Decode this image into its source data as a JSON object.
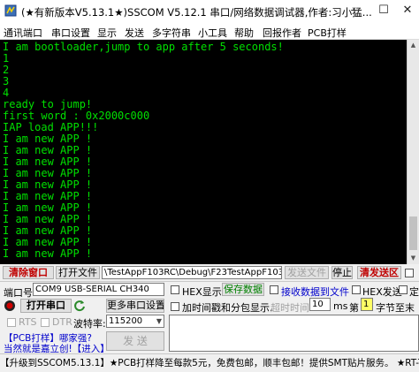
{
  "window": {
    "title": "(★有新版本V5.13.1★)SSCOM V5.12.1 串口/网络数据调试器,作者:习小猛...",
    "min": "—",
    "max": "☐",
    "close": "✕"
  },
  "menu": [
    "通讯端口",
    "串口设置",
    "显示",
    "发送",
    "多字符串",
    "小工具",
    "帮助",
    "回报作者",
    "PCB打样"
  ],
  "terminal": {
    "lines": [
      "I am bootloader,jump to app after 5 seconds!",
      "1",
      "2",
      "3",
      "4",
      "ready to jump!",
      "first word : 0x2000c000",
      "IAP load APP!!!",
      "I am new APP !",
      "I am new APP !",
      "I am new APP !",
      "I am new APP !",
      "I am new APP !",
      "I am new APP !",
      "I am new APP !",
      "I am new APP !",
      "I am new APP !",
      "I am new APP !",
      "I am new APP !"
    ],
    "scroll_up": "▲",
    "scroll_down": "▼"
  },
  "row1": {
    "clear": "清除窗口",
    "open_file": "打开文件",
    "file_path": "\\TestAppF103RC\\Debug\\F23TestAppF103RC.bin",
    "send_file": "发送文件",
    "stop": "停止",
    "clear_send": "清发送区",
    "extra_check": ""
  },
  "row2": {
    "port_label": "端口号",
    "port_value": "COM9 USB-SERIAL CH340",
    "hex_display": "HEX显示",
    "save_data": "保存数据",
    "recv_to_file": "接收数据到文件",
    "hex_send": "HEX发送",
    "timed": "定"
  },
  "row3": {
    "open_port": "打开串口",
    "more_settings": "更多串口设置",
    "timestamp": "加时间戳和分包显示.",
    "timeout": "超时时间",
    "timeout_value": "10",
    "ms": "ms",
    "page_label": "第",
    "page_value": "1",
    "byte_label": "字节至末"
  },
  "row4": {
    "rts": "RTS",
    "dtr": "DTR",
    "baud_label": "波特率:",
    "baud_value": "115200"
  },
  "promo": {
    "line1": "【PCB打样】哪家强?",
    "line2": "当然就是嘉立创!【进入】",
    "send": "发 送"
  },
  "status": "【升级到SSCOM5.13.1】★PCB打样降至每款5元，免费包邮，顺丰包邮！提供SMT贴片服务。 ★RT-Thread来",
  "colors": {
    "terminal_bg": "#000000",
    "terminal_fg": "#00e000",
    "red": "#c00000",
    "blue": "#0000cc",
    "green": "#008000"
  }
}
